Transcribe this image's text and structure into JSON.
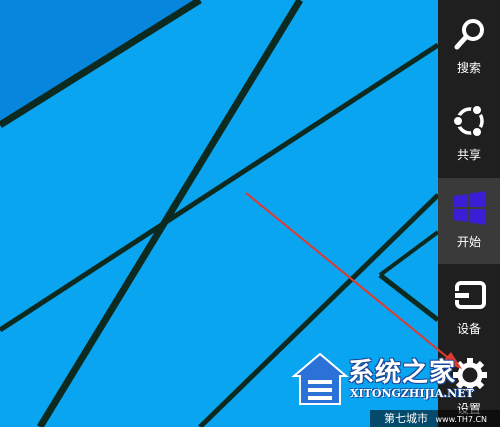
{
  "desktop": {
    "background_color": "#0aa5f0"
  },
  "charms": [
    {
      "id": "search",
      "label": "搜索",
      "icon": "search-icon"
    },
    {
      "id": "share",
      "label": "共享",
      "icon": "share-icon"
    },
    {
      "id": "start",
      "label": "开始",
      "icon": "windows-logo-icon",
      "active": true
    },
    {
      "id": "devices",
      "label": "设备",
      "icon": "devices-icon"
    },
    {
      "id": "settings",
      "label": "设置",
      "icon": "gear-icon"
    }
  ],
  "watermark": {
    "title": "系统之家",
    "domain": "XITONGZHIJIA.NET",
    "banner_text": "第七城市",
    "banner_small": "www.TH7.CN"
  },
  "colors": {
    "charms_bg": "#1f1f1f",
    "charm_active_bg": "#3a3a3a",
    "windows_logo": "#3a1fd6",
    "arrow": "#e03a2e"
  }
}
